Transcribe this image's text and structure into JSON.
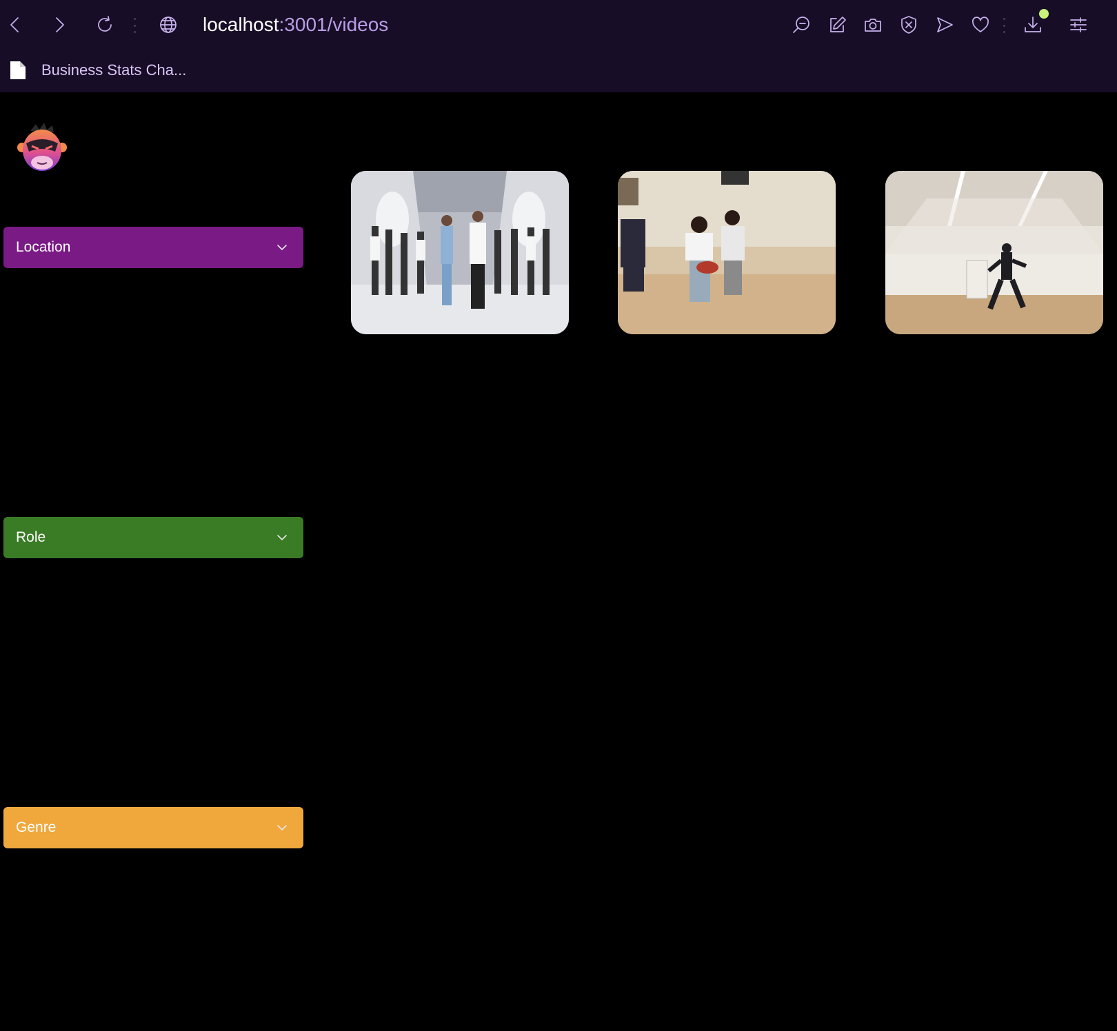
{
  "browser": {
    "url_host": "localhost",
    "url_path": ":3001/videos",
    "bookmark_label": "Business Stats Cha...",
    "icons": [
      "back-icon",
      "forward-icon",
      "reload-icon",
      "globe-icon",
      "zoom-out-icon",
      "edit-icon",
      "camera-icon",
      "shield-icon",
      "send-icon",
      "heart-icon",
      "download-icon",
      "settings-icon"
    ],
    "colors": {
      "toolbar": "#170d26",
      "icon": "#c8b3ef",
      "download_dot": "#c8f27a"
    }
  },
  "sidebar": {
    "logo_icon": "monkey-logo-icon",
    "filters": [
      {
        "label": "Location",
        "color": "#7a1a85"
      },
      {
        "label": "Role",
        "color": "#3a7b25"
      },
      {
        "label": "Genre",
        "color": "#f0a83d"
      }
    ]
  },
  "videos": [
    {
      "thumbnail": "group-dance-studio"
    },
    {
      "thumbnail": "dancers-with-football"
    },
    {
      "thumbnail": "solo-dancer-hall"
    }
  ]
}
